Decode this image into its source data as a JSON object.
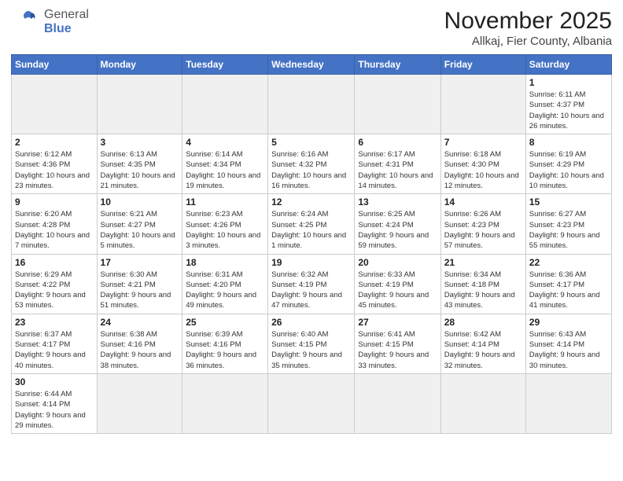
{
  "header": {
    "logo_text_normal": "General",
    "logo_text_bold": "Blue",
    "title": "November 2025",
    "subtitle": "Allkaj, Fier County, Albania"
  },
  "calendar": {
    "days_of_week": [
      "Sunday",
      "Monday",
      "Tuesday",
      "Wednesday",
      "Thursday",
      "Friday",
      "Saturday"
    ],
    "weeks": [
      [
        {
          "day": "",
          "info": ""
        },
        {
          "day": "",
          "info": ""
        },
        {
          "day": "",
          "info": ""
        },
        {
          "day": "",
          "info": ""
        },
        {
          "day": "",
          "info": ""
        },
        {
          "day": "",
          "info": ""
        },
        {
          "day": "1",
          "info": "Sunrise: 6:11 AM\nSunset: 4:37 PM\nDaylight: 10 hours and 26 minutes."
        }
      ],
      [
        {
          "day": "2",
          "info": "Sunrise: 6:12 AM\nSunset: 4:36 PM\nDaylight: 10 hours and 23 minutes."
        },
        {
          "day": "3",
          "info": "Sunrise: 6:13 AM\nSunset: 4:35 PM\nDaylight: 10 hours and 21 minutes."
        },
        {
          "day": "4",
          "info": "Sunrise: 6:14 AM\nSunset: 4:34 PM\nDaylight: 10 hours and 19 minutes."
        },
        {
          "day": "5",
          "info": "Sunrise: 6:16 AM\nSunset: 4:32 PM\nDaylight: 10 hours and 16 minutes."
        },
        {
          "day": "6",
          "info": "Sunrise: 6:17 AM\nSunset: 4:31 PM\nDaylight: 10 hours and 14 minutes."
        },
        {
          "day": "7",
          "info": "Sunrise: 6:18 AM\nSunset: 4:30 PM\nDaylight: 10 hours and 12 minutes."
        },
        {
          "day": "8",
          "info": "Sunrise: 6:19 AM\nSunset: 4:29 PM\nDaylight: 10 hours and 10 minutes."
        }
      ],
      [
        {
          "day": "9",
          "info": "Sunrise: 6:20 AM\nSunset: 4:28 PM\nDaylight: 10 hours and 7 minutes."
        },
        {
          "day": "10",
          "info": "Sunrise: 6:21 AM\nSunset: 4:27 PM\nDaylight: 10 hours and 5 minutes."
        },
        {
          "day": "11",
          "info": "Sunrise: 6:23 AM\nSunset: 4:26 PM\nDaylight: 10 hours and 3 minutes."
        },
        {
          "day": "12",
          "info": "Sunrise: 6:24 AM\nSunset: 4:25 PM\nDaylight: 10 hours and 1 minute."
        },
        {
          "day": "13",
          "info": "Sunrise: 6:25 AM\nSunset: 4:24 PM\nDaylight: 9 hours and 59 minutes."
        },
        {
          "day": "14",
          "info": "Sunrise: 6:26 AM\nSunset: 4:23 PM\nDaylight: 9 hours and 57 minutes."
        },
        {
          "day": "15",
          "info": "Sunrise: 6:27 AM\nSunset: 4:23 PM\nDaylight: 9 hours and 55 minutes."
        }
      ],
      [
        {
          "day": "16",
          "info": "Sunrise: 6:29 AM\nSunset: 4:22 PM\nDaylight: 9 hours and 53 minutes."
        },
        {
          "day": "17",
          "info": "Sunrise: 6:30 AM\nSunset: 4:21 PM\nDaylight: 9 hours and 51 minutes."
        },
        {
          "day": "18",
          "info": "Sunrise: 6:31 AM\nSunset: 4:20 PM\nDaylight: 9 hours and 49 minutes."
        },
        {
          "day": "19",
          "info": "Sunrise: 6:32 AM\nSunset: 4:19 PM\nDaylight: 9 hours and 47 minutes."
        },
        {
          "day": "20",
          "info": "Sunrise: 6:33 AM\nSunset: 4:19 PM\nDaylight: 9 hours and 45 minutes."
        },
        {
          "day": "21",
          "info": "Sunrise: 6:34 AM\nSunset: 4:18 PM\nDaylight: 9 hours and 43 minutes."
        },
        {
          "day": "22",
          "info": "Sunrise: 6:36 AM\nSunset: 4:17 PM\nDaylight: 9 hours and 41 minutes."
        }
      ],
      [
        {
          "day": "23",
          "info": "Sunrise: 6:37 AM\nSunset: 4:17 PM\nDaylight: 9 hours and 40 minutes."
        },
        {
          "day": "24",
          "info": "Sunrise: 6:38 AM\nSunset: 4:16 PM\nDaylight: 9 hours and 38 minutes."
        },
        {
          "day": "25",
          "info": "Sunrise: 6:39 AM\nSunset: 4:16 PM\nDaylight: 9 hours and 36 minutes."
        },
        {
          "day": "26",
          "info": "Sunrise: 6:40 AM\nSunset: 4:15 PM\nDaylight: 9 hours and 35 minutes."
        },
        {
          "day": "27",
          "info": "Sunrise: 6:41 AM\nSunset: 4:15 PM\nDaylight: 9 hours and 33 minutes."
        },
        {
          "day": "28",
          "info": "Sunrise: 6:42 AM\nSunset: 4:14 PM\nDaylight: 9 hours and 32 minutes."
        },
        {
          "day": "29",
          "info": "Sunrise: 6:43 AM\nSunset: 4:14 PM\nDaylight: 9 hours and 30 minutes."
        }
      ],
      [
        {
          "day": "30",
          "info": "Sunrise: 6:44 AM\nSunset: 4:14 PM\nDaylight: 9 hours and 29 minutes."
        },
        {
          "day": "",
          "info": ""
        },
        {
          "day": "",
          "info": ""
        },
        {
          "day": "",
          "info": ""
        },
        {
          "day": "",
          "info": ""
        },
        {
          "day": "",
          "info": ""
        },
        {
          "day": "",
          "info": ""
        }
      ]
    ]
  }
}
